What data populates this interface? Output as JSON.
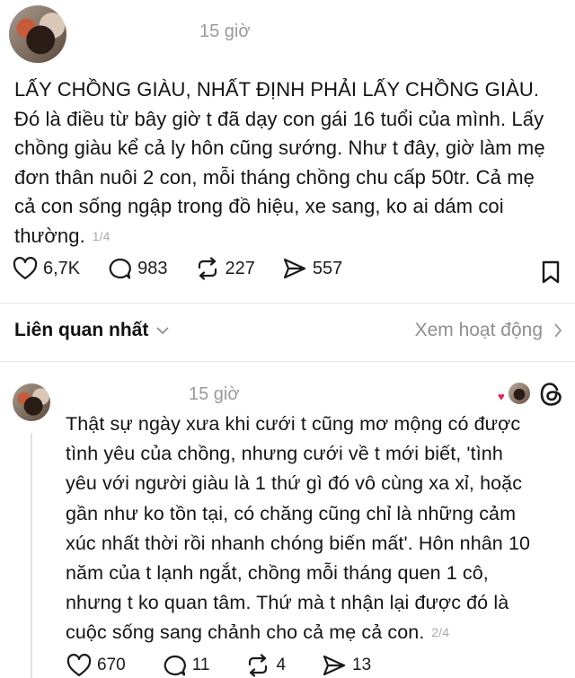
{
  "post": {
    "time": "15 giờ",
    "body": "LẤY CHỒNG GIÀU, NHẤT ĐỊNH PHẢI LẤY CHỒNG GIÀU.\nĐó là điều từ bây giờ t đã dạy con gái 16 tuổi của mình. Lấy\nchồng giàu kể cả ly hôn cũng sướng. Như t đây, giờ làm mẹ\nđơn thân nuôi 2 con, mỗi tháng chồng chu cấp 50tr. Cả mẹ\ncả con sống ngập trong đồ hiệu, xe sang, ko ai dám coi\nthường.",
    "counter": "1/4",
    "likes": "6,7K",
    "comments": "983",
    "reposts": "227",
    "shares": "557"
  },
  "filter": {
    "label": "Liên quan nhất",
    "activity_label": "Xem hoạt động"
  },
  "reply": {
    "time": "15 giờ",
    "body": "Thật sự ngày xưa khi cưới t cũng mơ mộng có được\ntình yêu của chồng, nhưng cưới về t mới biết, 'tình\nyêu với người giàu là 1 thứ gì đó vô cùng xa xỉ, hoặc\ngần như ko tồn tại, có chăng cũng chỉ là những cảm\nxúc nhất thời rồi nhanh chóng biến mất'. Hôn nhân 10\nnăm của t lạnh ngắt, chồng mỗi tháng quen 1 cô,\nnhưng t ko quan tâm. Thứ mà t nhận lại được đó là\ncuộc sống sang chảnh cho cả mẹ cả con.",
    "counter": "2/4",
    "likes": "670",
    "comments": "11",
    "reposts": "4",
    "shares": "13"
  },
  "icons": {
    "like": "heart-icon",
    "comment": "comment-bubble-icon",
    "repost": "repost-icon",
    "share": "send-icon",
    "save": "bookmark-icon",
    "logo": "threads-logo-icon"
  }
}
